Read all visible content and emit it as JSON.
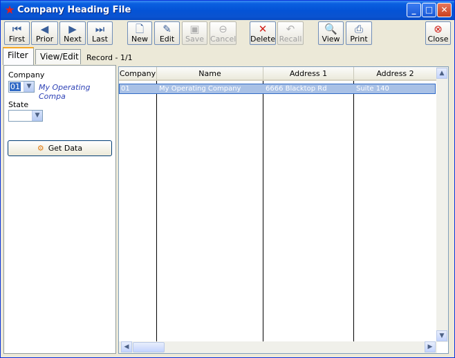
{
  "window": {
    "title": "Company Heading File",
    "controls": {
      "minimize": "_",
      "maximize": "□",
      "close": "✕"
    }
  },
  "toolbar": {
    "first": "First",
    "prior": "Prior",
    "next": "Next",
    "last": "Last",
    "new": "New",
    "edit": "Edit",
    "save": "Save",
    "cancel": "Cancel",
    "delete": "Delete",
    "recall": "Recall",
    "view": "View",
    "print": "Print",
    "close": "Close"
  },
  "tabs": {
    "filter": "Filter",
    "view_edit": "View/Edit",
    "record": "Record - 1/1"
  },
  "filter": {
    "company_label": "Company",
    "company_value": "01",
    "company_name": "My Operating Compa",
    "state_label": "State",
    "state_value": "",
    "get_data": "Get Data"
  },
  "grid": {
    "columns": [
      "Company",
      "Name",
      "Address 1",
      "Address 2"
    ],
    "rows": [
      {
        "company": "01",
        "name": "My Operating Company",
        "address1": "6666 Blacktop Rd",
        "address2": "Suite 140"
      }
    ]
  },
  "colors": {
    "title_bar": "#0453d6",
    "selection": "#a9c1e6",
    "accent_tab": "#f5a623"
  }
}
